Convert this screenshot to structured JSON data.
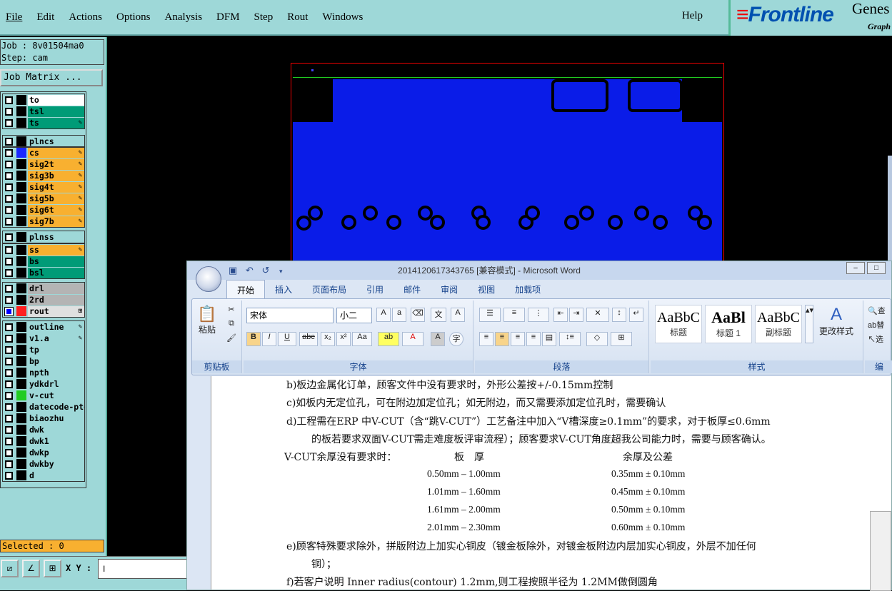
{
  "menu": {
    "items": [
      "File",
      "Edit",
      "Actions",
      "Options",
      "Analysis",
      "DFM",
      "Step",
      "Rout",
      "Windows"
    ],
    "help": "Help"
  },
  "logo": {
    "brand": "Frontline",
    "product": "Genes",
    "subtitle": "Graph"
  },
  "job": {
    "job_line": "Job : 8v01504ma0",
    "step_line": "Step: cam",
    "matrix_button": "Job Matrix ..."
  },
  "layers": [
    {
      "name": "to",
      "color": "#ffffff",
      "swatch": "#000000",
      "edit": false,
      "checked": false
    },
    {
      "name": "tsl",
      "color": "#009b77",
      "swatch": "#000000",
      "edit": false,
      "checked": false
    },
    {
      "name": "ts",
      "color": "#009b77",
      "swatch": "#000000",
      "edit": true,
      "checked": false
    },
    {
      "name": "plncs",
      "color": "#9ed8d8",
      "swatch": "#000000",
      "edit": false,
      "checked": false
    },
    {
      "name": "cs",
      "color": "#f8b030",
      "swatch": "#1a28ff",
      "edit": true,
      "checked": false
    },
    {
      "name": "sig2t",
      "color": "#f8b030",
      "swatch": "#000000",
      "edit": true,
      "checked": false
    },
    {
      "name": "sig3b",
      "color": "#f8b030",
      "swatch": "#000000",
      "edit": true,
      "checked": false
    },
    {
      "name": "sig4t",
      "color": "#f8b030",
      "swatch": "#000000",
      "edit": true,
      "checked": false
    },
    {
      "name": "sig5b",
      "color": "#f8b030",
      "swatch": "#000000",
      "edit": true,
      "checked": false
    },
    {
      "name": "sig6t",
      "color": "#f8b030",
      "swatch": "#000000",
      "edit": true,
      "checked": false
    },
    {
      "name": "sig7b",
      "color": "#f8b030",
      "swatch": "#000000",
      "edit": true,
      "checked": false
    },
    {
      "name": "plnss",
      "color": "#9ed8d8",
      "swatch": "#000000",
      "edit": false,
      "checked": false
    },
    {
      "name": "ss",
      "color": "#f8b030",
      "swatch": "#000000",
      "edit": true,
      "checked": false
    },
    {
      "name": "bs",
      "color": "#009b77",
      "swatch": "#000000",
      "edit": false,
      "checked": false
    },
    {
      "name": "bsl",
      "color": "#009b77",
      "swatch": "#000000",
      "edit": false,
      "checked": false
    },
    {
      "name": "drl",
      "color": "#b4b4b4",
      "swatch": "#000000",
      "edit": false,
      "checked": false
    },
    {
      "name": "2rd",
      "color": "#b4b4b4",
      "swatch": "#000000",
      "edit": false,
      "checked": false
    },
    {
      "name": "rout",
      "color": "#e0e0e0",
      "swatch": "#ff2020",
      "edit": "drag",
      "checked": true
    },
    {
      "name": "outline",
      "color": "#9ed8d8",
      "swatch": "#000000",
      "edit": true,
      "checked": false
    },
    {
      "name": "v1.a",
      "color": "#9ed8d8",
      "swatch": "#000000",
      "edit": true,
      "checked": false
    },
    {
      "name": "tp",
      "color": "#9ed8d8",
      "swatch": "#000000",
      "edit": false,
      "checked": false
    },
    {
      "name": "bp",
      "color": "#9ed8d8",
      "swatch": "#000000",
      "edit": false,
      "checked": false
    },
    {
      "name": "npth",
      "color": "#9ed8d8",
      "swatch": "#000000",
      "edit": false,
      "checked": false
    },
    {
      "name": "ydkdrl",
      "color": "#9ed8d8",
      "swatch": "#000000",
      "edit": false,
      "checked": false
    },
    {
      "name": "v-cut",
      "color": "#9ed8d8",
      "swatch": "#22cc22",
      "edit": false,
      "checked": false
    },
    {
      "name": "datecode-pte",
      "color": "#9ed8d8",
      "swatch": "#000000",
      "edit": false,
      "checked": false
    },
    {
      "name": "biaozhu",
      "color": "#9ed8d8",
      "swatch": "#000000",
      "edit": false,
      "checked": false
    },
    {
      "name": "dwk",
      "color": "#9ed8d8",
      "swatch": "#000000",
      "edit": false,
      "checked": false
    },
    {
      "name": "dwk1",
      "color": "#9ed8d8",
      "swatch": "#000000",
      "edit": false,
      "checked": false
    },
    {
      "name": "dwkp",
      "color": "#9ed8d8",
      "swatch": "#000000",
      "edit": false,
      "checked": false
    },
    {
      "name": "dwkby",
      "color": "#9ed8d8",
      "swatch": "#000000",
      "edit": false,
      "checked": false
    },
    {
      "name": "d",
      "color": "#9ed8d8",
      "swatch": "#000000",
      "edit": false,
      "checked": false
    }
  ],
  "status": {
    "selected": "Selected : 0",
    "xy_label": "X Y :",
    "xy_value": "I"
  },
  "word": {
    "title": "2014120617343765 [兼容模式] - Microsoft Word",
    "tabs": [
      "开始",
      "插入",
      "页面布局",
      "引用",
      "邮件",
      "审阅",
      "视图",
      "加载项"
    ],
    "ribbon": {
      "clipboard_label": "剪贴板",
      "paste": "粘贴",
      "font_label": "字体",
      "font_name": "宋体",
      "font_size": "小二",
      "paragraph_label": "段落",
      "styles_label": "样式",
      "change_styles": "更改样式",
      "styles": [
        {
          "preview": "AaBbC",
          "name": "标题"
        },
        {
          "preview": "AaBl",
          "name": "标题 1"
        },
        {
          "preview": "AaBbC",
          "name": "副标题"
        }
      ],
      "edit_label": "编",
      "edit_items": [
        "查",
        "替",
        "选"
      ]
    },
    "doc": {
      "line_b": "b)板边金属化订单，顾客文件中没有要求时，外形公差按+/-0.15mm控制",
      "line_c": "c)如板内无定位孔，可在附边加定位孔；如无附边，而又需要添加定位孔时，需要确认",
      "line_d1": "d)工程需在ERP 中V-CUT（含“跳V-CUT”）工艺备注中加入“V槽深度≥0.1mm”的要求，对于板厚≤0.6mm",
      "line_d2": "的板若要求双面V-CUT需走难度板评审流程）；顾客要求V-CUT角度超我公司能力时，需要与顾客确认。",
      "vcut_heading": "V-CUT余厚没有要求时：",
      "col1_header": "板　厚",
      "col2_header": "余厚及公差",
      "rows": [
        {
          "thickness": "0.50mm – 1.00mm",
          "residual": "0.35mm ± 0.10mm"
        },
        {
          "thickness": "1.01mm – 1.60mm",
          "residual": "0.45mm ± 0.10mm"
        },
        {
          "thickness": "1.61mm – 2.00mm",
          "residual": "0.50mm ± 0.10mm"
        },
        {
          "thickness": "2.01mm – 2.30mm",
          "residual": "0.60mm ± 0.10mm"
        }
      ],
      "line_e1": "e)顾客特殊要求除外，拼版附边上加实心铜皮（镀金板除外，对镀金板附边内层加实心铜皮，外层不加任何",
      "line_e2": "铜）；",
      "line_f": "f)若客户说明 Inner radius(contour) 1.2mm,则工程按照半径为 1.2MM做倒圆角"
    }
  }
}
